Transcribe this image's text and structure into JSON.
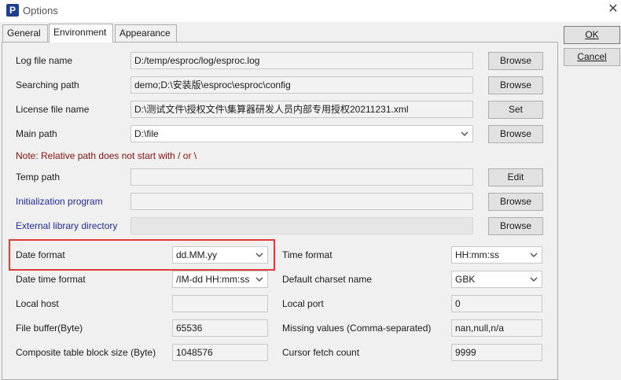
{
  "window": {
    "title": "Options",
    "app_icon": "P",
    "close": "✕"
  },
  "tabs": [
    {
      "label": "General"
    },
    {
      "label": "Environment"
    },
    {
      "label": "Appearance"
    }
  ],
  "buttons": {
    "ok": "OK",
    "cancel": "Cancel",
    "browse": "Browse",
    "set": "Set",
    "edit": "Edit"
  },
  "env": {
    "log_file": {
      "label": "Log file name",
      "value": "D:/temp/esproc/log/esproc.log"
    },
    "searching_path": {
      "label": "Searching path",
      "value": "demo;D:\\安装版\\esproc\\esproc\\config"
    },
    "license_file": {
      "label": "License file name",
      "value": "D:\\测试文件\\授权文件\\集算器研发人员内部专用授权20211231.xml"
    },
    "main_path": {
      "label": "Main path",
      "value": "D:\\file"
    },
    "note": "Note: Relative path does not start with / or \\",
    "temp_path": {
      "label": "Temp path",
      "value": ""
    },
    "init_program": {
      "label": "Initialization program",
      "value": ""
    },
    "ext_lib": {
      "label": "External library directory",
      "value": ""
    },
    "date_format": {
      "label": "Date format",
      "value": "dd.MM.yy"
    },
    "time_format": {
      "label": "Time format",
      "value": "HH:mm:ss"
    },
    "datetime_format": {
      "label": "Date time format",
      "value": "/IM-dd HH:mm:ss"
    },
    "charset": {
      "label": "Default charset name",
      "value": "GBK"
    },
    "local_host": {
      "label": "Local host",
      "value": ""
    },
    "local_port": {
      "label": "Local port",
      "value": "0"
    },
    "file_buffer": {
      "label": "File buffer(Byte)",
      "value": "65536"
    },
    "missing_values": {
      "label": "Missing values (Comma-separated)",
      "value": "nan,null,n/a"
    },
    "block_size": {
      "label": "Composite table block size (Byte)",
      "value": "1048576"
    },
    "cursor_fetch": {
      "label": "Cursor fetch count",
      "value": "9999"
    }
  },
  "colors": {
    "highlight": "#e03a3a",
    "note": "#8b1010",
    "blue_label": "#1f2c9c"
  }
}
